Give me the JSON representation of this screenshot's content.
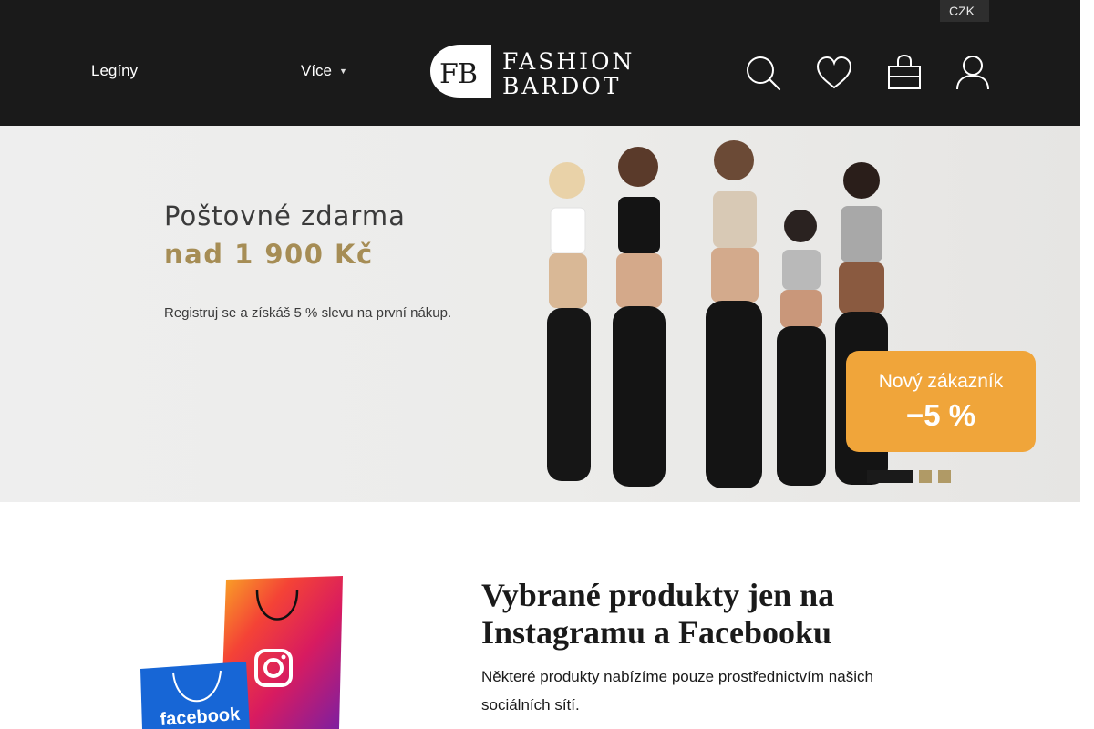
{
  "header": {
    "currency": "CZK",
    "nav": {
      "leginy": "Legíny",
      "vice": "Více",
      "vice_chevron": "chevron-down-icon"
    },
    "logo": {
      "line1": "FASHION",
      "line2": "BARDOT",
      "mark": "FB"
    },
    "icons": [
      "search-icon",
      "heart-icon",
      "shopping-bag-icon",
      "user-icon"
    ]
  },
  "banner": {
    "headline": "Poštovné zdarma",
    "headline2": "nad 1 900 Kč",
    "subtext": "Registruj se a získáš 5 % slevu na první nákup.",
    "badge_line1": "Nový zákazník",
    "badge_line2": "−5 %",
    "slides_total": 3,
    "active_slide": 1
  },
  "social": {
    "title": "Vybrané produkty jen na Instagramu a Facebooku",
    "text": "Některé produkty nabízíme pouze prostřednictvím našich sociálních sítí.",
    "bag_label": "facebook"
  },
  "colors": {
    "header_bg": "#1a1a1a",
    "accent_gold": "#a68d55",
    "badge_orange": "#f0a53a"
  }
}
